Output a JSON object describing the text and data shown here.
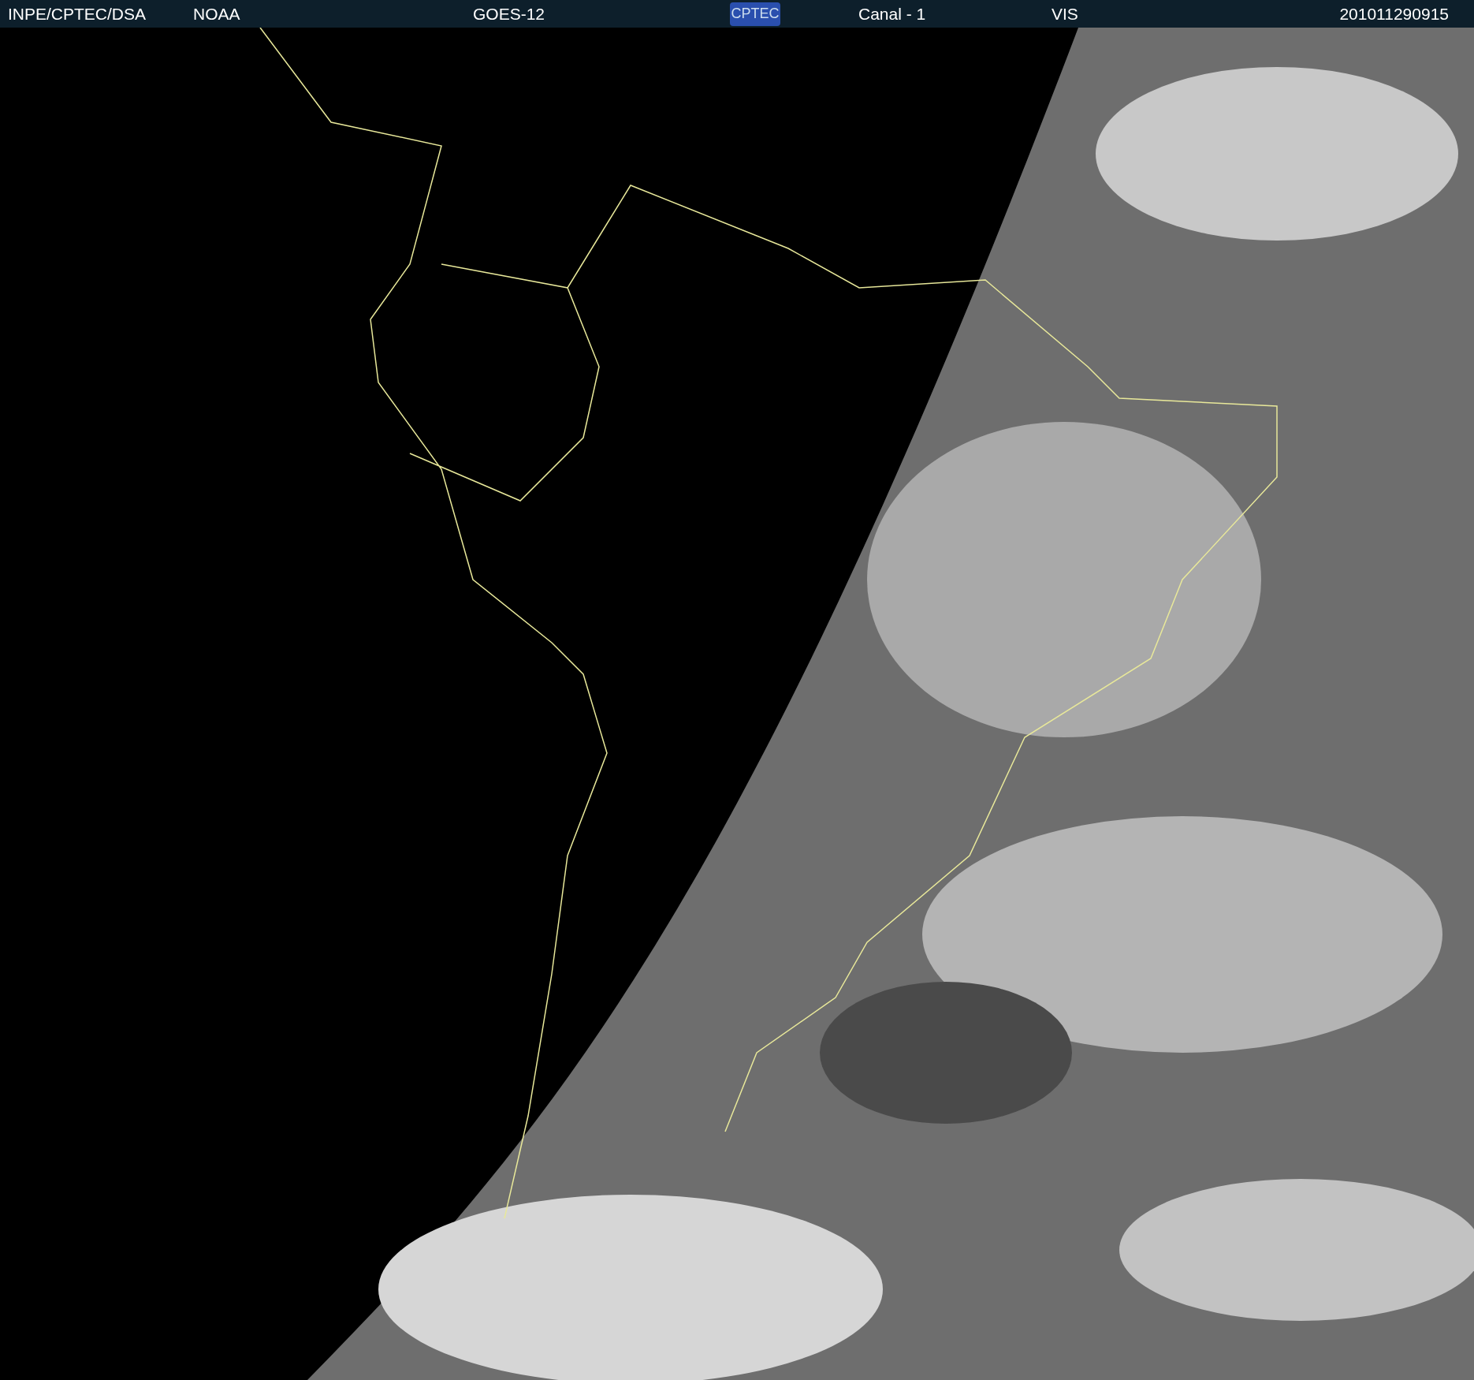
{
  "header": {
    "source": "INPE/CPTEC/DSA",
    "agency": "NOAA",
    "satellite": "GOES-12",
    "logo": "CPTEC",
    "channel": "Canal - 1",
    "band": "VIS",
    "timestamp": "201011290915"
  }
}
